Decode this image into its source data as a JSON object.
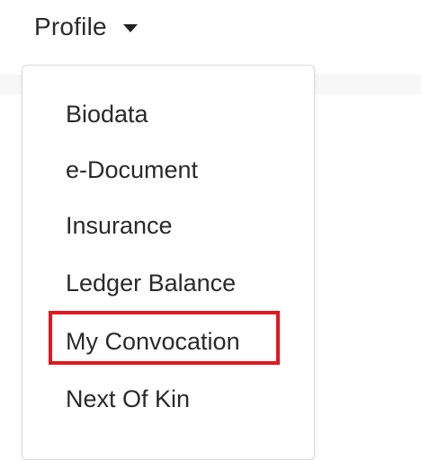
{
  "profile_menu": {
    "toggle_label": "Profile",
    "items": [
      {
        "label": "Biodata"
      },
      {
        "label": "e-Document"
      },
      {
        "label": "Insurance"
      },
      {
        "label": "Ledger Balance"
      },
      {
        "label": "My Convocation",
        "highlighted": true
      },
      {
        "label": "Next Of Kin"
      }
    ]
  },
  "colors": {
    "highlight_border": "#e0181f",
    "text": "#2a2a2a",
    "menu_border": "#d9d9d9"
  }
}
